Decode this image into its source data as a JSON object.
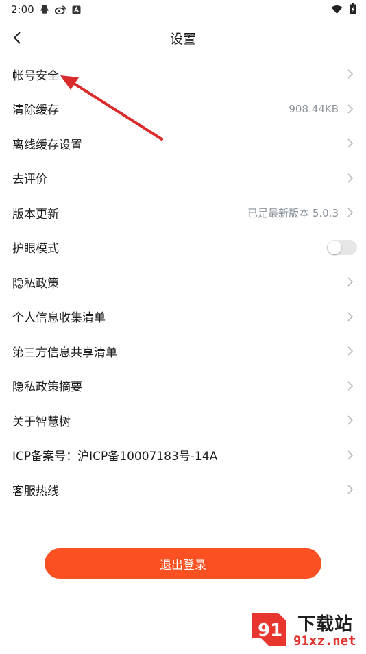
{
  "status_bar": {
    "time": "2:00",
    "icons_left": [
      "qq-icon",
      "weibo-icon",
      "app-notification-icon"
    ],
    "icons_right": [
      "wifi-icon",
      "battery-charging-icon"
    ]
  },
  "header": {
    "title": "设置"
  },
  "settings": [
    {
      "label": "帐号安全",
      "value": "",
      "type": "link"
    },
    {
      "label": "清除缓存",
      "value": "908.44KB",
      "type": "link"
    },
    {
      "label": "离线缓存设置",
      "value": "",
      "type": "link"
    },
    {
      "label": "去评价",
      "value": "",
      "type": "link"
    },
    {
      "label": "版本更新",
      "value": "已是最新版本 5.0.3",
      "type": "link"
    },
    {
      "label": "护眼模式",
      "value": "",
      "type": "toggle",
      "toggle_on": false
    },
    {
      "label": "隐私政策",
      "value": "",
      "type": "link"
    },
    {
      "label": "个人信息收集清单",
      "value": "",
      "type": "link"
    },
    {
      "label": "第三方信息共享清单",
      "value": "",
      "type": "link"
    },
    {
      "label": "隐私政策摘要",
      "value": "",
      "type": "link"
    },
    {
      "label": "关于智慧树",
      "value": "",
      "type": "link"
    },
    {
      "label": "ICP备案号：沪ICP备10007183号-14A",
      "value": "",
      "type": "link"
    },
    {
      "label": "客服热线",
      "value": "",
      "type": "link"
    }
  ],
  "logout": {
    "label": "退出登录"
  },
  "watermark": {
    "top": "下载站",
    "bottom": "91xz.net"
  },
  "colors": {
    "accent": "#fb5021",
    "arrow": "#d92b2b",
    "value_text": "#8a9299",
    "chevron": "#b9b9b9"
  }
}
